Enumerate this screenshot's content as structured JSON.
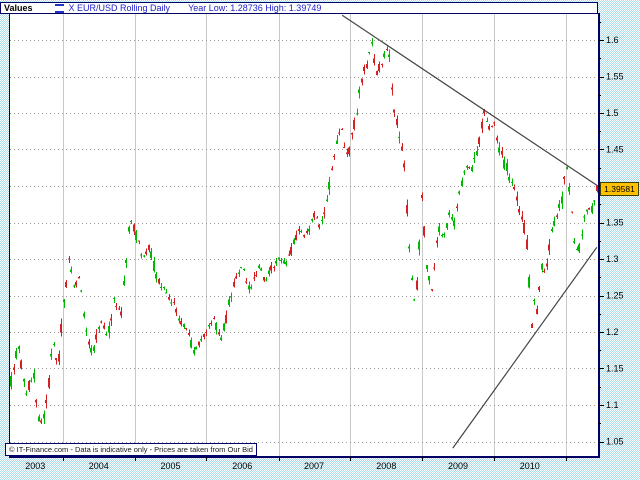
{
  "header": {
    "panel_label": "Values",
    "series_label": "X EUR/USD Rolling Daily",
    "range_label": "Year Low: 1.28736 High: 1.39749"
  },
  "price_label": "1.39581",
  "footer_note": "© IT-Finance.com - Data is indicative only - Prices are taken from Our Bid",
  "chart_data": {
    "type": "candlestick",
    "title": "EUR/USD Rolling Daily",
    "year_low": 1.28736,
    "year_high": 1.39749,
    "last_price": 1.39581,
    "legend_position": "top-left",
    "grid": true,
    "x_axis": {
      "labels": [
        "2003",
        "2004",
        "2005",
        "2006",
        "2007",
        "2008",
        "2009",
        "2010"
      ],
      "label_frac": [
        0.043,
        0.151,
        0.273,
        0.395,
        0.517,
        0.64,
        0.762,
        0.884
      ],
      "gridlines_frac": [
        0.09,
        0.212,
        0.334,
        0.457,
        0.579,
        0.701,
        0.823,
        0.945
      ]
    },
    "y_axis": {
      "top_value": 1.6,
      "bottom_value": 1.05,
      "major_step": 0.05,
      "minor_step": 0.025,
      "labels_top_to_bottom": [
        "1.6",
        "1.55",
        "1.5",
        "1.45",
        "1.4",
        "1.35",
        "1.3",
        "1.25",
        "1.2",
        "1.15",
        "1.1",
        "1.05"
      ]
    },
    "price_path_anchors": [
      [
        0.0,
        1.125
      ],
      [
        0.014,
        1.185
      ],
      [
        0.027,
        1.112
      ],
      [
        0.039,
        1.146
      ],
      [
        0.051,
        1.07
      ],
      [
        0.061,
        1.094
      ],
      [
        0.073,
        1.186
      ],
      [
        0.082,
        1.158
      ],
      [
        0.092,
        1.242
      ],
      [
        0.1,
        1.296
      ],
      [
        0.109,
        1.258
      ],
      [
        0.117,
        1.28
      ],
      [
        0.129,
        1.198
      ],
      [
        0.141,
        1.17
      ],
      [
        0.153,
        1.214
      ],
      [
        0.165,
        1.194
      ],
      [
        0.177,
        1.242
      ],
      [
        0.189,
        1.224
      ],
      [
        0.204,
        1.352
      ],
      [
        0.214,
        1.336
      ],
      [
        0.226,
        1.302
      ],
      [
        0.236,
        1.316
      ],
      [
        0.25,
        1.276
      ],
      [
        0.264,
        1.256
      ],
      [
        0.276,
        1.242
      ],
      [
        0.289,
        1.216
      ],
      [
        0.301,
        1.202
      ],
      [
        0.313,
        1.172
      ],
      [
        0.323,
        1.186
      ],
      [
        0.335,
        1.202
      ],
      [
        0.347,
        1.216
      ],
      [
        0.359,
        1.19
      ],
      [
        0.372,
        1.234
      ],
      [
        0.386,
        1.282
      ],
      [
        0.398,
        1.288
      ],
      [
        0.41,
        1.256
      ],
      [
        0.423,
        1.29
      ],
      [
        0.435,
        1.27
      ],
      [
        0.447,
        1.288
      ],
      [
        0.459,
        1.3
      ],
      [
        0.469,
        1.292
      ],
      [
        0.481,
        1.318
      ],
      [
        0.493,
        1.344
      ],
      [
        0.503,
        1.33
      ],
      [
        0.515,
        1.362
      ],
      [
        0.527,
        1.344
      ],
      [
        0.539,
        1.382
      ],
      [
        0.551,
        1.446
      ],
      [
        0.563,
        1.476
      ],
      [
        0.575,
        1.44
      ],
      [
        0.587,
        1.492
      ],
      [
        0.597,
        1.546
      ],
      [
        0.605,
        1.562
      ],
      [
        0.614,
        1.597
      ],
      [
        0.622,
        1.554
      ],
      [
        0.633,
        1.574
      ],
      [
        0.643,
        1.594
      ],
      [
        0.651,
        1.51
      ],
      [
        0.662,
        1.468
      ],
      [
        0.67,
        1.432
      ],
      [
        0.679,
        1.31
      ],
      [
        0.687,
        1.242
      ],
      [
        0.694,
        1.274
      ],
      [
        0.699,
        1.398
      ],
      [
        0.706,
        1.318
      ],
      [
        0.711,
        1.272
      ],
      [
        0.718,
        1.252
      ],
      [
        0.728,
        1.344
      ],
      [
        0.736,
        1.326
      ],
      [
        0.747,
        1.36
      ],
      [
        0.755,
        1.348
      ],
      [
        0.765,
        1.398
      ],
      [
        0.776,
        1.428
      ],
      [
        0.786,
        1.42
      ],
      [
        0.796,
        1.454
      ],
      [
        0.806,
        1.502
      ],
      [
        0.815,
        1.478
      ],
      [
        0.823,
        1.488
      ],
      [
        0.83,
        1.455
      ],
      [
        0.84,
        1.433
      ],
      [
        0.852,
        1.408
      ],
      [
        0.864,
        1.378
      ],
      [
        0.874,
        1.344
      ],
      [
        0.881,
        1.312
      ],
      [
        0.886,
        1.2
      ],
      [
        0.891,
        1.242
      ],
      [
        0.896,
        1.226
      ],
      [
        0.903,
        1.29
      ],
      [
        0.91,
        1.28
      ],
      [
        0.92,
        1.334
      ],
      [
        0.929,
        1.356
      ],
      [
        0.937,
        1.374
      ],
      [
        0.946,
        1.428
      ],
      [
        0.952,
        1.392
      ],
      [
        0.959,
        1.334
      ],
      [
        0.966,
        1.306
      ],
      [
        0.975,
        1.35
      ],
      [
        0.983,
        1.374
      ],
      [
        0.988,
        1.362
      ],
      [
        0.993,
        1.386
      ],
      [
        0.998,
        1.396
      ]
    ],
    "trendlines": [
      {
        "name": "descending-resistance",
        "f1": 0.565,
        "p1": 1.634,
        "f2": 0.998,
        "p2": 1.401
      },
      {
        "name": "ascending-support",
        "f1": 0.753,
        "p1": 1.041,
        "f2": 0.998,
        "p2": 1.316
      }
    ],
    "candle_count": 235,
    "seed": 7,
    "colors": {
      "up": "#00b800",
      "down": "#d42020",
      "grid_vertical": "#c8c8c8",
      "grid_horizontal": "#9a9a9a",
      "trendline": "#444444",
      "border": "#000066",
      "header_text": "#2020cc",
      "price_label_bg": "#ffc000",
      "background": "#a9dceb"
    }
  }
}
